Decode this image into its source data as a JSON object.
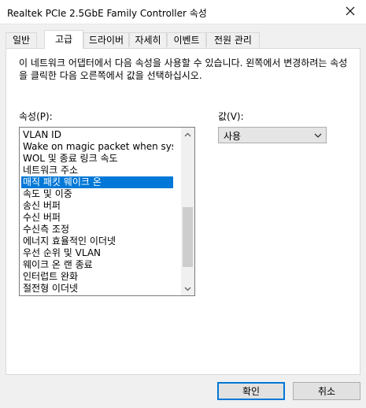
{
  "window": {
    "title": "Realtek PCIe 2.5GbE Family Controller 속성"
  },
  "tabs": [
    {
      "label": "일반"
    },
    {
      "label": "고급"
    },
    {
      "label": "드라이버"
    },
    {
      "label": "자세히"
    },
    {
      "label": "이벤트"
    },
    {
      "label": "전원 관리"
    }
  ],
  "active_tab": "고급",
  "description": "이 네트워크 어댑터에서 다음 속성을 사용할 수 있습니다. 왼쪽에서 변경하려는 속성을 클릭한 다음 오른쪽에서 값을 선택하십시오.",
  "property": {
    "label": "속성(P):",
    "items": [
      "VLAN ID",
      "Wake on magic packet when system",
      "WOL 및 종료 링크 속도",
      "네트워크 주소",
      "매직 패킷 웨이크 온",
      "속도 및 이중",
      "송신 버퍼",
      "수신 버퍼",
      "수신측 조정",
      "에너지 효율적인 이더넷",
      "우선 순위 및 VLAN",
      "웨이크 온 랜 종료",
      "인터럽트 완화",
      "절전형 이더넷"
    ],
    "selected": "매직 패킷 웨이크 온"
  },
  "value": {
    "label": "값(V):",
    "selected": "사용"
  },
  "buttons": {
    "ok": "확인",
    "cancel": "취소"
  },
  "colors": {
    "selection": "#0078d7",
    "default_button_border": "#0078d7"
  }
}
